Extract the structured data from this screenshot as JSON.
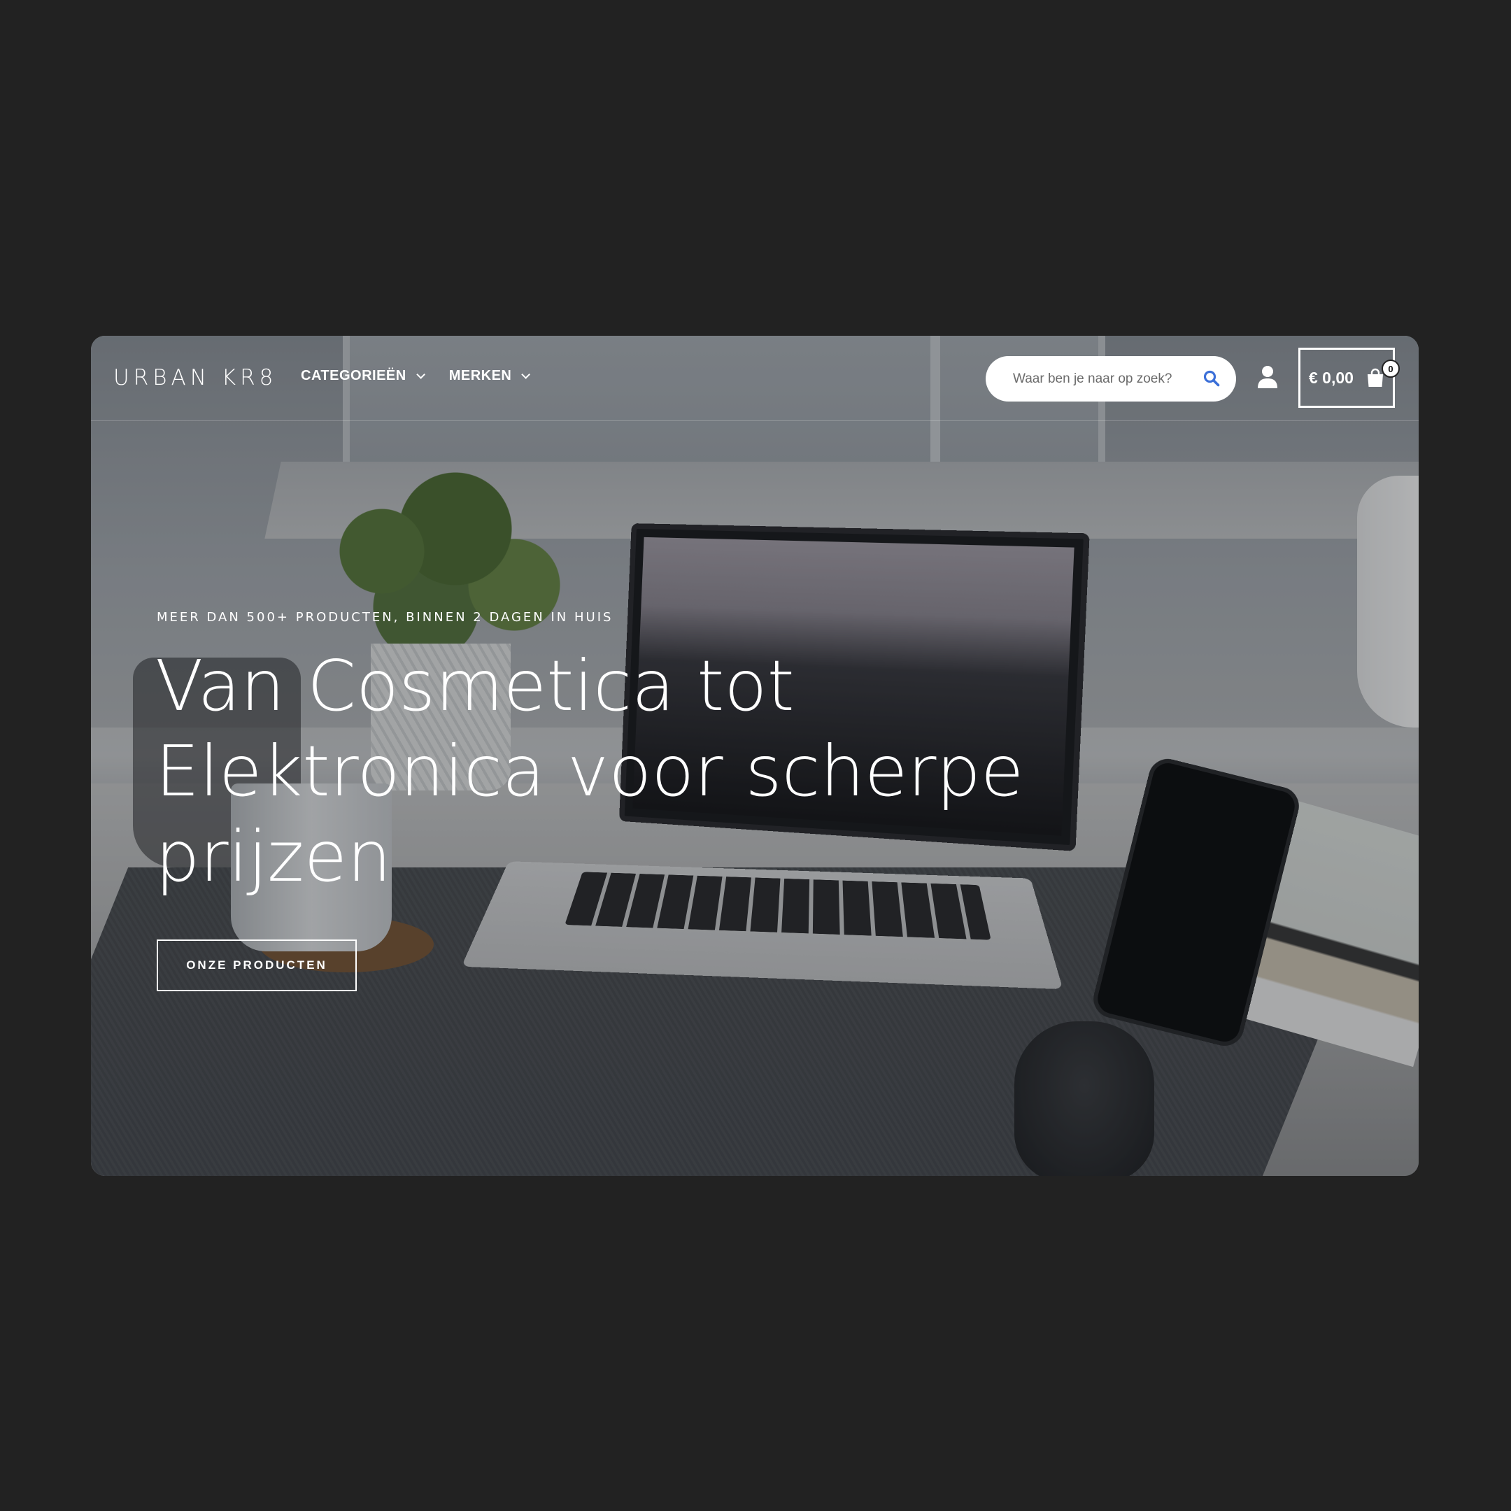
{
  "header": {
    "logo_text": "URBAN KR8",
    "nav": [
      {
        "label": "CATEGORIEËN",
        "icon": "chevron-down-icon"
      },
      {
        "label": "MERKEN",
        "icon": "chevron-down-icon"
      }
    ],
    "search": {
      "placeholder": "Waar ben je naar op zoek?",
      "value": "",
      "icon": "search-icon",
      "icon_color": "#3b6fd8"
    },
    "account_icon": "user-icon",
    "cart": {
      "total": "€ 0,00",
      "count": "0",
      "icon": "shopping-bag-icon"
    }
  },
  "hero": {
    "eyebrow": "MEER DAN 500+ PRODUCTEN, BINNEN 2 DAGEN IN HUIS",
    "title": "Van Cosmetica tot Elektronica voor scherpe prijzen",
    "cta_label": "ONZE PRODUCTEN"
  },
  "colors": {
    "page_background": "#222222",
    "text": "#ffffff",
    "accent": "#3b6fd8"
  }
}
